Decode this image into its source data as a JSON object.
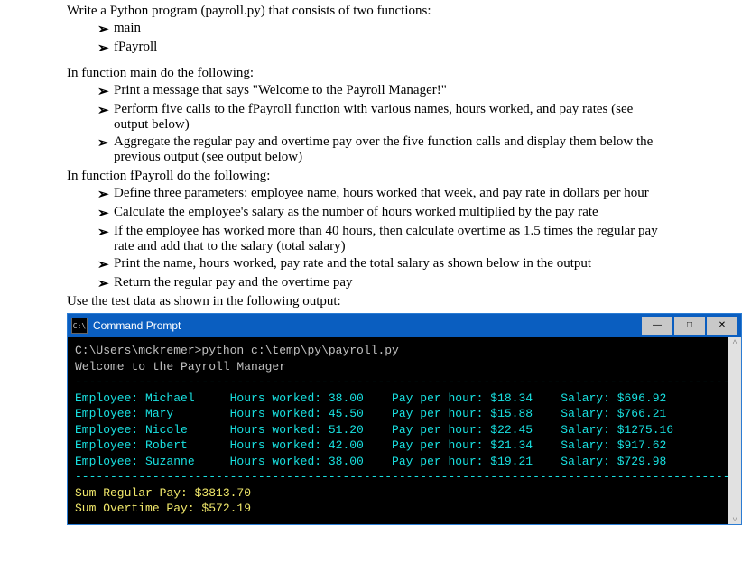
{
  "intro": "Write a Python program (payroll.py) that consists of two functions:",
  "intro_bullets": [
    "main",
    "fPayroll"
  ],
  "main_head": "In function main do the following:",
  "main_bullets": [
    "Print a message that says \"Welcome to the Payroll Manager!\"",
    "Perform five calls to the fPayroll function with various names, hours worked, and pay rates (see output below)",
    "Aggregate the regular pay and overtime pay over the five function calls and display them below the previous output (see output below)"
  ],
  "fpay_head": "In function fPayroll do the following:",
  "fpay_bullets": [
    "Define three parameters: employee name, hours worked that week, and pay rate in dollars per hour",
    "Calculate the employee's salary as the number of hours worked multiplied by the pay rate",
    "If the employee has worked more than 40 hours, then calculate overtime as 1.5 times the regular pay rate and add that to the salary (total salary)",
    "Print the name, hours worked, pay rate and the total salary as shown below in the output",
    "Return the regular pay and the overtime pay"
  ],
  "testdata_line": "Use the test data as shown in the following output:",
  "terminal": {
    "title": "Command Prompt",
    "icon_text": "C:\\",
    "command": "C:\\Users\\mckremer>python c:\\temp\\py\\payroll.py",
    "welcome": "Welcome to the Payroll Manager",
    "rows": [
      {
        "name": "Michael",
        "hours": "38.00",
        "rate": "$18.34",
        "salary": "$696.92"
      },
      {
        "name": "Mary",
        "hours": "45.50",
        "rate": "$15.88",
        "salary": "$766.21"
      },
      {
        "name": "Nicole",
        "hours": "51.20",
        "rate": "$22.45",
        "salary": "$1275.16"
      },
      {
        "name": "Robert",
        "hours": "42.00",
        "rate": "$21.34",
        "salary": "$917.62"
      },
      {
        "name": "Suzanne",
        "hours": "38.00",
        "rate": "$19.21",
        "salary": "$729.98"
      }
    ],
    "sum_regular": "Sum Regular Pay: $3813.70",
    "sum_overtime": "Sum Overtime Pay: $572.19",
    "divider": "----------------------------------------------------------------------------------------------",
    "labels": {
      "employee": "Employee: ",
      "hours": "Hours worked: ",
      "rate": "Pay per hour: ",
      "salary": "Salary: "
    }
  },
  "win_btn_glyphs": {
    "min": "—",
    "max": "□",
    "close": "✕"
  },
  "scroll_glyphs": {
    "up": "˄",
    "down": "˅"
  }
}
